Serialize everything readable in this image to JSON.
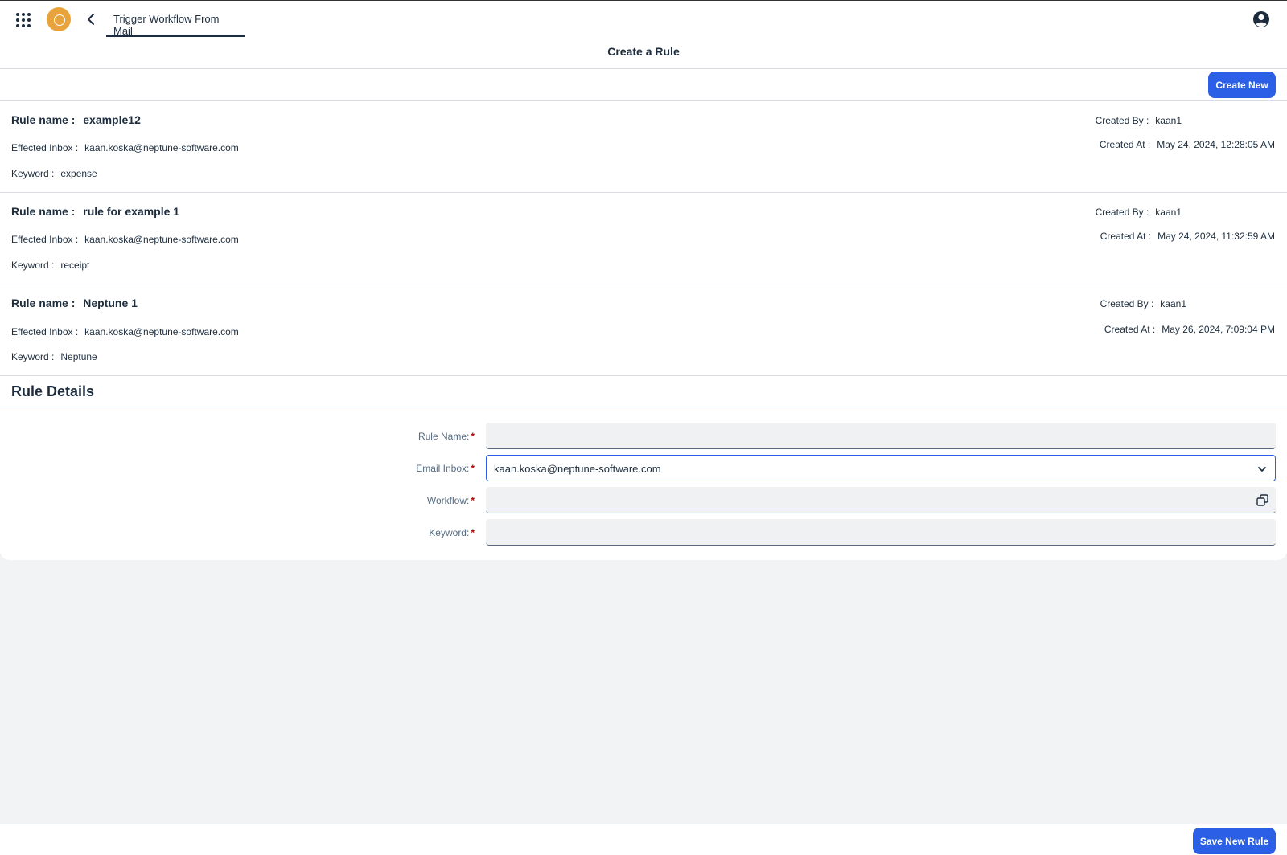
{
  "shell": {
    "app_title": "Trigger Workflow From Mail"
  },
  "page": {
    "title": "Create a Rule"
  },
  "toolbar": {
    "create_new_label": "Create New"
  },
  "labels": {
    "rule_name": "Rule name :",
    "effected_inbox": "Effected Inbox :",
    "keyword": "Keyword :",
    "created_by": "Created By :",
    "created_at": "Created At :"
  },
  "rules": [
    {
      "name": "example12",
      "inbox": "kaan.koska@neptune-software.com",
      "keyword": "expense",
      "created_by": "kaan1",
      "created_at": "May 24, 2024, 12:28:05 AM"
    },
    {
      "name": "rule for example 1",
      "inbox": "kaan.koska@neptune-software.com",
      "keyword": "receipt",
      "created_by": "kaan1",
      "created_at": "May 24, 2024, 11:32:59 AM"
    },
    {
      "name": "Neptune 1",
      "inbox": "kaan.koska@neptune-software.com",
      "keyword": "Neptune",
      "created_by": "kaan1",
      "created_at": "May 26, 2024, 7:09:04 PM"
    }
  ],
  "details": {
    "title": "Rule Details",
    "rule_name_label": "Rule Name:",
    "rule_name_value": "",
    "email_inbox_label": "Email Inbox:",
    "email_inbox_value": "kaan.koska@neptune-software.com",
    "workflow_label": "Workflow:",
    "workflow_value": "",
    "keyword_label": "Keyword:",
    "keyword_value": "",
    "required_mark": "*"
  },
  "footer": {
    "save_label": "Save New Rule"
  },
  "colors": {
    "accent": "#2a5fe6",
    "logo": "#e8a33d",
    "required": "#aa0808"
  },
  "icons": {
    "menu": "grid-icon",
    "back": "chevron-left-icon",
    "user": "user-icon",
    "select": "chevron-down-icon",
    "value_help": "value-help-icon"
  }
}
